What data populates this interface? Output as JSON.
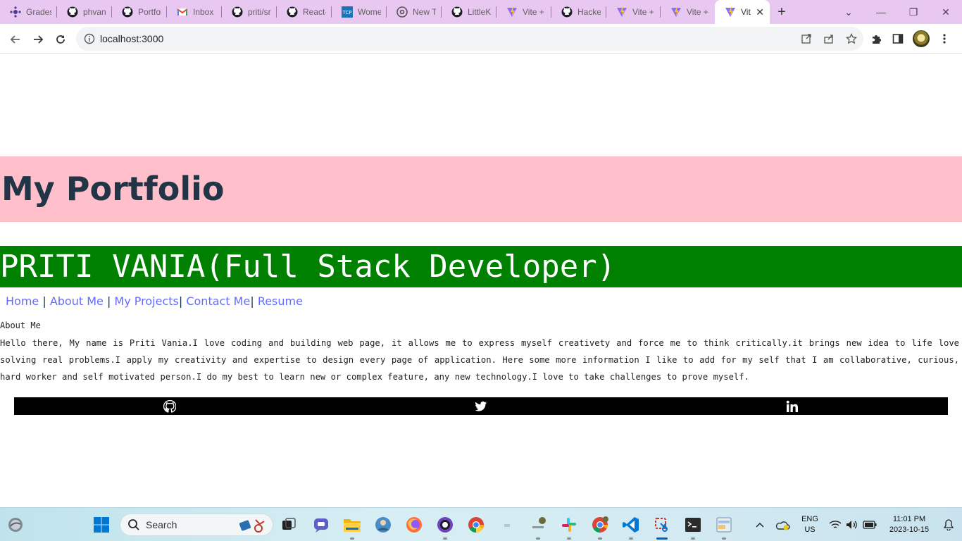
{
  "browser": {
    "tabs": [
      {
        "label": "Grades",
        "icon": "canvas-icon"
      },
      {
        "label": "phvani",
        "icon": "github-icon"
      },
      {
        "label": "Portfoli",
        "icon": "github-icon"
      },
      {
        "label": "Inbox (",
        "icon": "gmail-icon"
      },
      {
        "label": "priti/sr",
        "icon": "github-icon"
      },
      {
        "label": "React-s",
        "icon": "github-icon"
      },
      {
        "label": "Wome",
        "icon": "tcp-icon"
      },
      {
        "label": "New Ta",
        "icon": "chrome-icon"
      },
      {
        "label": "LittleKi",
        "icon": "github-icon"
      },
      {
        "label": "Vite + I",
        "icon": "vite-icon"
      },
      {
        "label": "Hacker",
        "icon": "github-icon"
      },
      {
        "label": "Vite +",
        "icon": "vite-icon"
      },
      {
        "label": "Vite +",
        "icon": "vite-icon"
      },
      {
        "label": "Vit",
        "icon": "vite-icon",
        "active": true
      }
    ],
    "url": "localhost:3000"
  },
  "page": {
    "banner_title": "My Portfolio",
    "name_heading": "PRITI VANIA(Full Stack Developer)",
    "nav": {
      "home": "Home",
      "about": "About Me",
      "projects": "My Projects",
      "contact": "Contact Me",
      "resume": "Resume"
    },
    "about_title": "About Me",
    "about_text": "Hello there, My name is Priti Vania.I love coding and building web page, it allows me to express myself creativety and force me to think critically.it brings new idea to life love solving real problems.I apply my creativity and expertise to design every page of application. Here some more information I like to add for my self that I am collaborative, curious, hard worker and self motivated person.I do my best to learn new or complex feature, any new technology.I love to take challenges to prove myself.",
    "social": [
      "github-icon",
      "twitter-icon",
      "linkedin-icon"
    ],
    "colors": {
      "banner_bg": "#ffc0cb",
      "banner_text": "#213547",
      "name_bg": "#008000",
      "link": "#646cff",
      "social_bg": "#000000"
    }
  },
  "taskbar": {
    "search_label": "Search",
    "lang_line1": "ENG",
    "lang_line2": "US",
    "time": "11:01 PM",
    "date": "2023-10-15"
  }
}
